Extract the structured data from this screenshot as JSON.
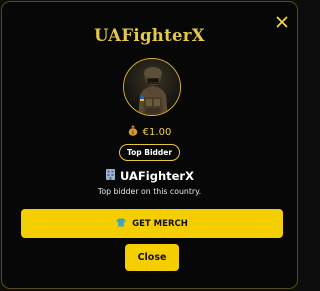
{
  "modal": {
    "title": "UAFighterX",
    "close_icon": "close-icon",
    "avatar_icon": "soldier-avatar",
    "amount": {
      "icon": "money-bag-icon",
      "text": "€1.00"
    },
    "badge": "Top Bidder",
    "name": {
      "icon": "office-building-icon",
      "text": "UAFighterX"
    },
    "description": "Top bidder on this country.",
    "merch_button": {
      "icon": "shirt-icon",
      "label": "GET MERCH"
    },
    "close_button": "Close"
  },
  "colors": {
    "accent": "#F5CE00",
    "title_gold": "#E3C84A",
    "background": "#070707",
    "border": "#5A4A10"
  }
}
